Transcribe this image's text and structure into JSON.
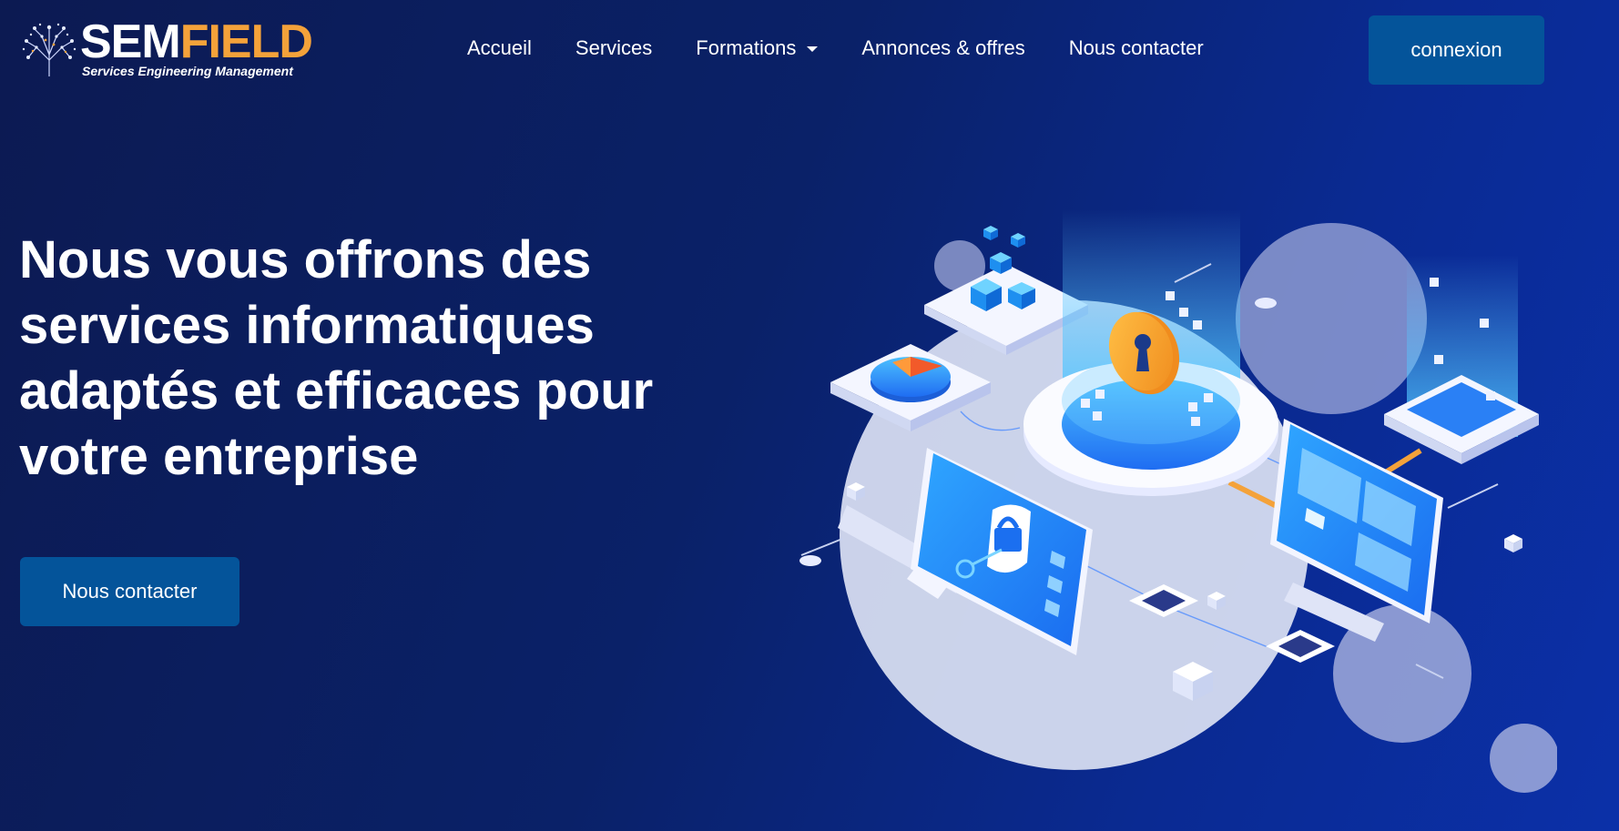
{
  "brand": {
    "name_part1": "SEM",
    "name_part2": "FIELD",
    "tagline": "Services Engineering Management",
    "accent_color": "#f4a23a"
  },
  "nav": {
    "items": [
      {
        "label": "Accueil"
      },
      {
        "label": "Services"
      },
      {
        "label": "Formations",
        "has_dropdown": true
      },
      {
        "label": "Annonces & offres"
      },
      {
        "label": "Nous contacter"
      }
    ],
    "login_label": "connexion"
  },
  "hero": {
    "title": "Nous vous offrons des services informatiques adaptés et efficaces pour votre entreprise",
    "cta_label": "Nous contacter",
    "button_color": "#04549a"
  },
  "icons": {
    "logo": "tree-circuit-icon",
    "dropdown": "chevron-down-icon",
    "illustration": "isometric-cyber-security-illustration"
  }
}
